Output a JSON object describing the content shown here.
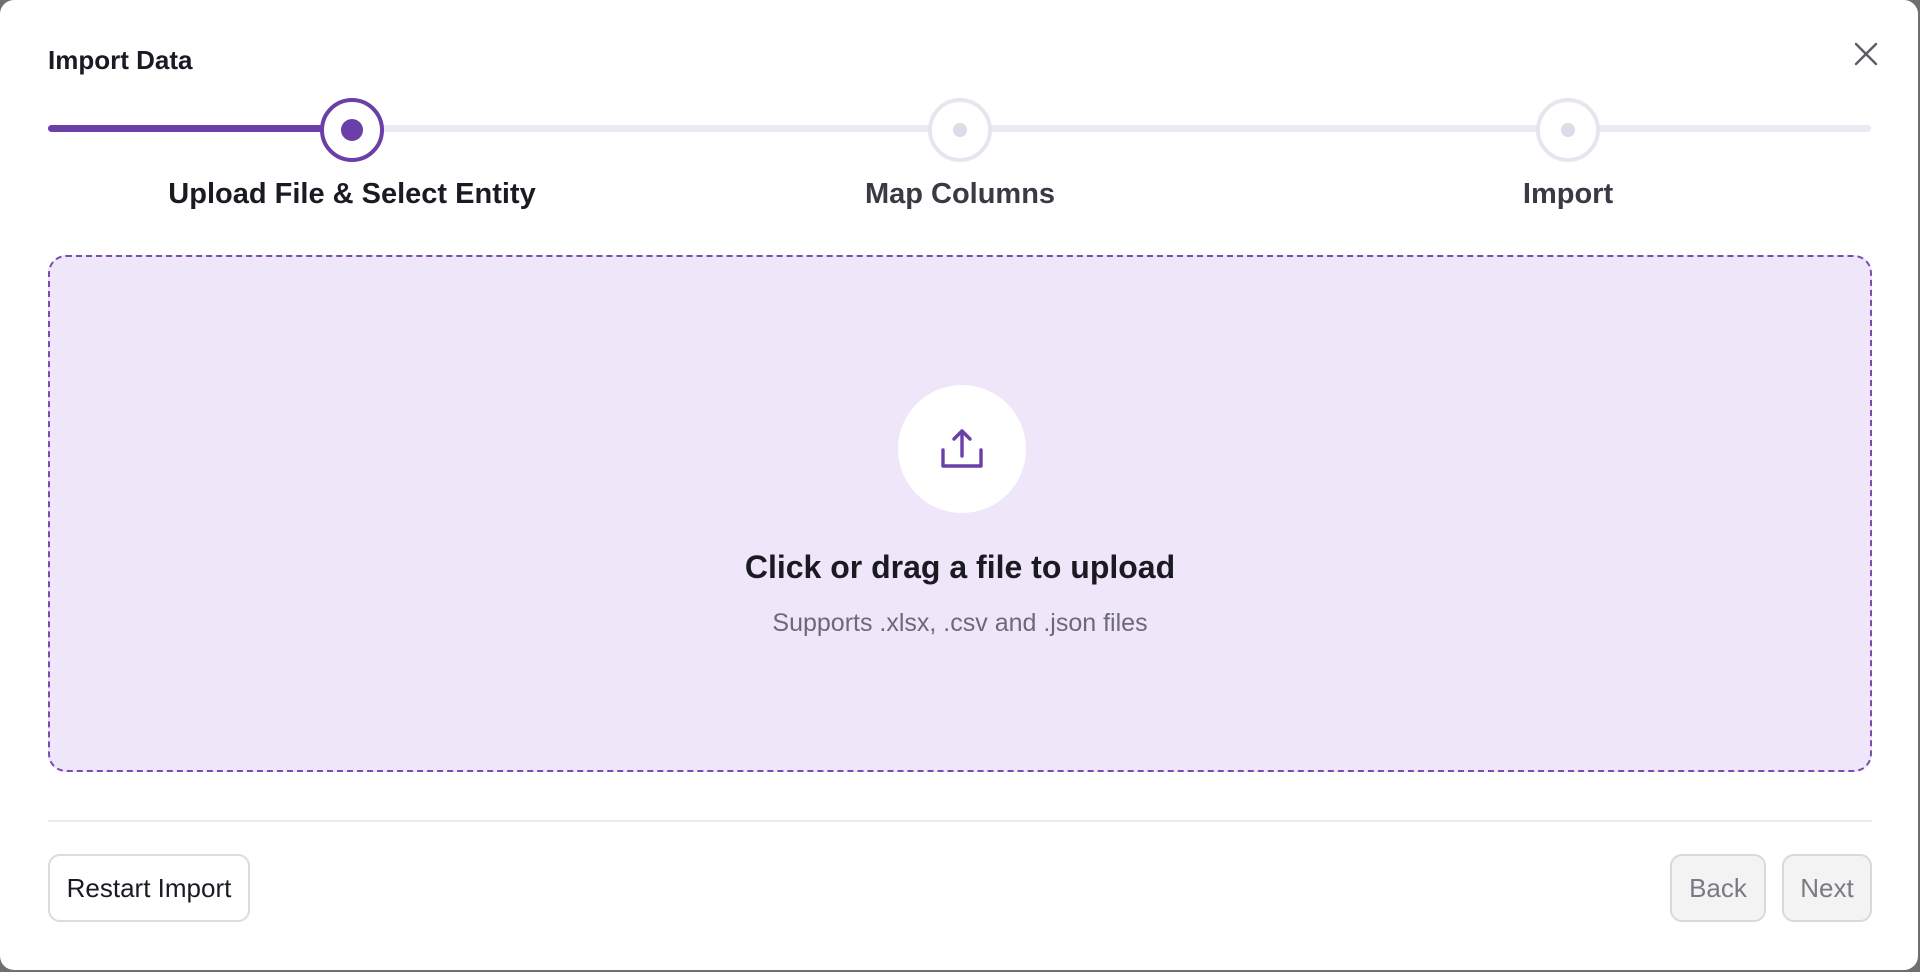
{
  "modal": {
    "title": "Import Data"
  },
  "stepper": {
    "steps": [
      {
        "label": "Upload File & Select Entity",
        "state": "active"
      },
      {
        "label": "Map Columns",
        "state": "pending"
      },
      {
        "label": "Import",
        "state": "pending"
      }
    ],
    "accent_color": "#6b3fa8"
  },
  "dropzone": {
    "icon": "upload-icon",
    "title": "Click or drag a file to upload",
    "subtitle": "Supports .xlsx, .csv and .json files",
    "background_color": "#efe7f9"
  },
  "footer": {
    "restart_label": "Restart Import",
    "back_label": "Back",
    "next_label": "Next"
  }
}
